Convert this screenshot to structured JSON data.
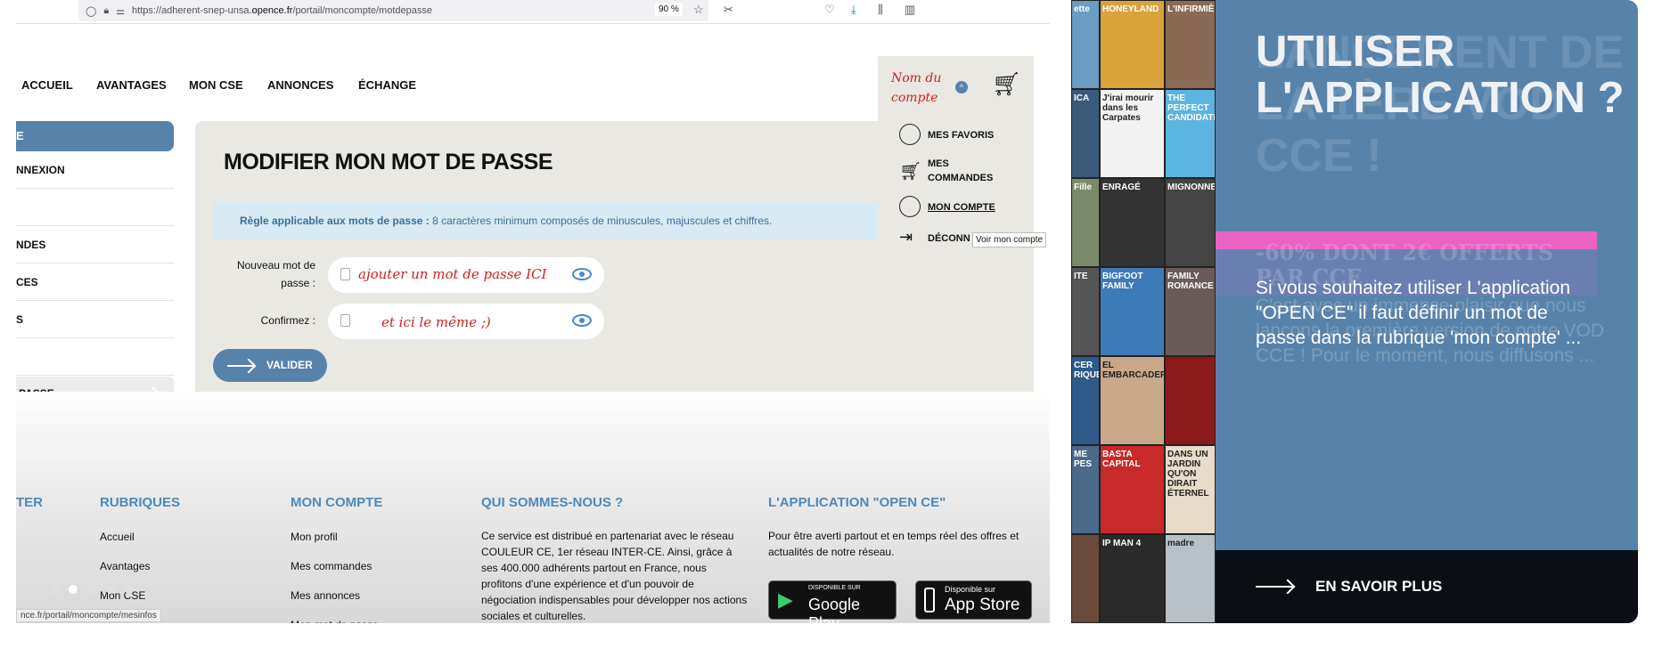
{
  "browser": {
    "url_prefix": "https://adherent-snep-unsa.",
    "url_domain": "opence.fr",
    "url_path": "/portail/moncompte/motdepasse",
    "zoom": "90 %",
    "status_url": "nce.fr/portail/moncompte/mesinfos"
  },
  "nav": {
    "items": [
      "ACCUEIL",
      "AVANTAGES",
      "MON CSE",
      "ANNONCES",
      "ÉCHANGE"
    ]
  },
  "account": {
    "name": "Nom du compte",
    "menu": [
      "MES FAVORIS",
      "MES COMMANDES",
      "MON COMPTE",
      "DÉCONN"
    ],
    "tooltip": "Voir mon compte"
  },
  "sidebar": {
    "top": "E",
    "items": [
      "NNEXION",
      "",
      "NDES",
      "CES",
      "S",
      ""
    ],
    "last": "PASSE"
  },
  "form": {
    "title": "MODIFIER MON MOT DE PASSE",
    "rule_bold": "Règle applicable aux mots de passe :",
    "rule_text": " 8 caractères minimum composés de minuscules, majuscules et chiffres.",
    "new_label": "Nouveau mot de passe :",
    "new_value": "ajouter un mot de passe ICI",
    "confirm_label": "Confirmez :",
    "confirm_value": "et ici le même ;)",
    "submit": "VALIDER"
  },
  "footer": {
    "col0_heading": "TER",
    "rubriques": {
      "heading": "RUBRIQUES",
      "links": [
        "Accueil",
        "Avantages",
        "Mon CSE"
      ]
    },
    "compte": {
      "heading": "MON COMPTE",
      "links": [
        "Mon profil",
        "Mes commandes",
        "Mes annonces",
        "Mon mot de passe"
      ]
    },
    "qui": {
      "heading": "QUI SOMMES-NOUS ?",
      "text": "Ce service est distribué en partenariat avec le réseau COULEUR CE, 1er réseau INTER-CE. Ainsi, grâce à ses 400.000 adhérents partout en France, nous profitons d'une expérience et d'un pouvoir de négociation indispensables pour développer nos actions sociales et culturelles."
    },
    "app": {
      "heading": "L'APPLICATION \"OPEN CE\"",
      "text": "Pour être averti partout et en temps réel des offres et actualités de notre réseau.",
      "google_small": "DISPONIBLE SUR",
      "google": "Google Play",
      "apple_small": "Disponible sur",
      "apple": "App Store"
    }
  },
  "posters": [
    "ette",
    "HONEYLAND",
    "L'INFIRMIÈRE",
    "ICA",
    "J'irai mourir dans les Carpates",
    "THE PERFECT CANDIDATE",
    "Fille",
    "ENRAGÉ",
    "MIGNONNES",
    "ITE",
    "BIGFOOT FAMILY",
    "FAMILY ROMANCE",
    "CER RIQUE",
    "EL EMBARCADERO",
    "",
    "ME PES",
    "BASTA CAPITAL",
    "DANS UN JARDIN QU'ON DIRAIT ÉTERNEL",
    "",
    "IP MAN 4",
    "madre"
  ],
  "panel": {
    "title": "UTILISER L'APPLICATION ?",
    "ghost_title": "LANCEMENT DE LA 1ÈRE VOD CCE !",
    "ghost_offer": "-60% DONT 2€ OFFERTS PAR CCE",
    "ghost_text": "C'est avec un immense plaisir que nous lançons la première version de notre VOD CCE ! Pour le moment, nous diffusons ...",
    "text": "Si vous souhaitez utiliser L'application \"OPEN CE\" il faut définir un mot de passe dans la rubrique 'mon compte' ...",
    "cta": "EN SAVOIR PLUS"
  },
  "colors": {
    "accent": "#5783ab",
    "pink": "#ea62c4",
    "annotation": "#d31f1f",
    "band": "#0b0f14"
  }
}
